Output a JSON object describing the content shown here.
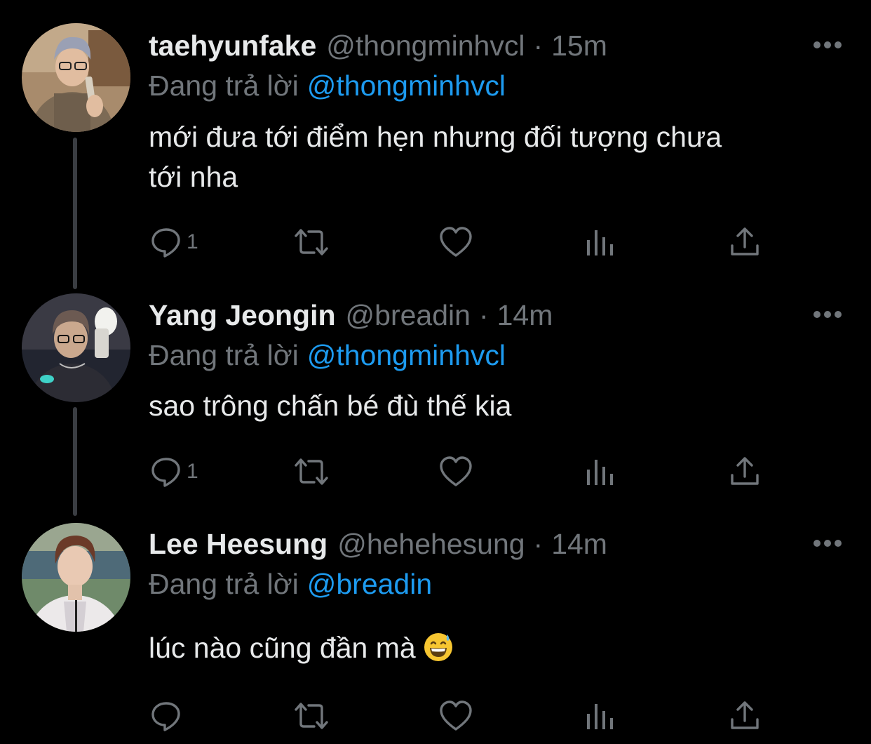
{
  "colors": {
    "background": "#000000",
    "primary_text": "#e7e9ea",
    "secondary_text": "#71767b",
    "link": "#1d9bf0",
    "thread_line": "#3a3d42"
  },
  "tweets": [
    {
      "display_name": "taehyunfake",
      "handle": "@thongminhvcl",
      "separator": "·",
      "time": "15m",
      "reply_prefix": "Đang trả lời",
      "reply_to": "@thongminhvcl",
      "text_line1": "mới đưa tới điểm hẹn nhưng đối tượng chưa",
      "text_line2": "tới nha",
      "reply_count": "1",
      "icons": [
        "reply-icon",
        "retweet-icon",
        "like-icon",
        "analytics-icon",
        "share-icon",
        "more-icon"
      ]
    },
    {
      "display_name": "Yang Jeongin",
      "handle": "@breadin",
      "separator": "·",
      "time": "14m",
      "reply_prefix": "Đang trả lời",
      "reply_to": "@thongminhvcl",
      "text_line1": "sao trông chấn bé đù thế kia",
      "reply_count": "1",
      "icons": [
        "reply-icon",
        "retweet-icon",
        "like-icon",
        "analytics-icon",
        "share-icon",
        "more-icon"
      ]
    },
    {
      "display_name": "Lee Heesung",
      "handle": "@hehehesung",
      "separator": "·",
      "time": "14m",
      "reply_prefix": "Đang trả lời",
      "reply_to": "@breadin",
      "text_line1": "lúc nào cũng đần mà",
      "emoji": "grinning-face-with-sweat",
      "reply_count": "",
      "icons": [
        "reply-icon",
        "retweet-icon",
        "like-icon",
        "analytics-icon",
        "share-icon",
        "more-icon"
      ]
    }
  ]
}
